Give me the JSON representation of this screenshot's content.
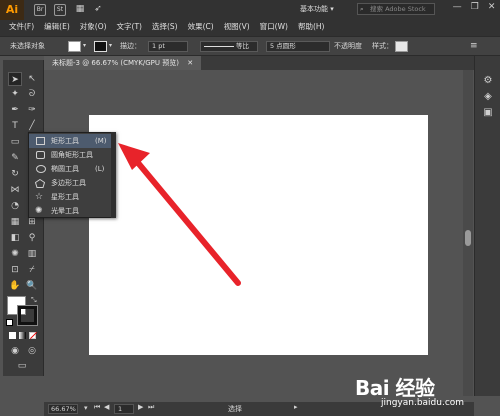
{
  "app": {
    "logo": "Ai"
  },
  "titlebar": {
    "icon1": "Br",
    "icon2": "St",
    "workspace": "基本功能 ▾",
    "search_placeholder": "搜索 Adobe Stock",
    "window_controls": [
      "—",
      "❐",
      "✕"
    ]
  },
  "menu": [
    "文件(F)",
    "编辑(E)",
    "对象(O)",
    "文字(T)",
    "选择(S)",
    "效果(C)",
    "视图(V)",
    "窗口(W)",
    "帮助(H)"
  ],
  "controlbar": {
    "selection_label": "未选择对象",
    "fill_color": "#ffffff",
    "stroke_label": "描边：",
    "stroke_weight": "1 pt",
    "stroke_style_label": "等比",
    "brush_label": "5 点圆形",
    "opacity_label": "不透明度",
    "style_label": "样式："
  },
  "document_tab": {
    "label": "未标题-3 @ 66.67% (CMYK/GPU 预览)",
    "close": "✕"
  },
  "flyout": {
    "items": [
      {
        "label": "矩形工具",
        "shortcut": "(M)",
        "selected": true,
        "shape": "rect"
      },
      {
        "label": "圆角矩形工具",
        "shortcut": "",
        "selected": false,
        "shape": "roundrect"
      },
      {
        "label": "椭圆工具",
        "shortcut": "(L)",
        "selected": false,
        "shape": "ellipse"
      },
      {
        "label": "多边形工具",
        "shortcut": "",
        "selected": false,
        "shape": "polygon"
      },
      {
        "label": "星形工具",
        "shortcut": "",
        "selected": false,
        "shape": "star"
      },
      {
        "label": "光晕工具",
        "shortcut": "",
        "selected": false,
        "shape": "flare"
      }
    ]
  },
  "statusbar": {
    "zoom": "66.67%",
    "page": "1",
    "status": "选择"
  },
  "watermark": {
    "brand": "Bai 经验",
    "url": "jingyan.baidu.com"
  },
  "colors": {
    "arrow": "#e8232a",
    "selected_item": "#4d5b6e",
    "canvas_bg": "#535353"
  }
}
